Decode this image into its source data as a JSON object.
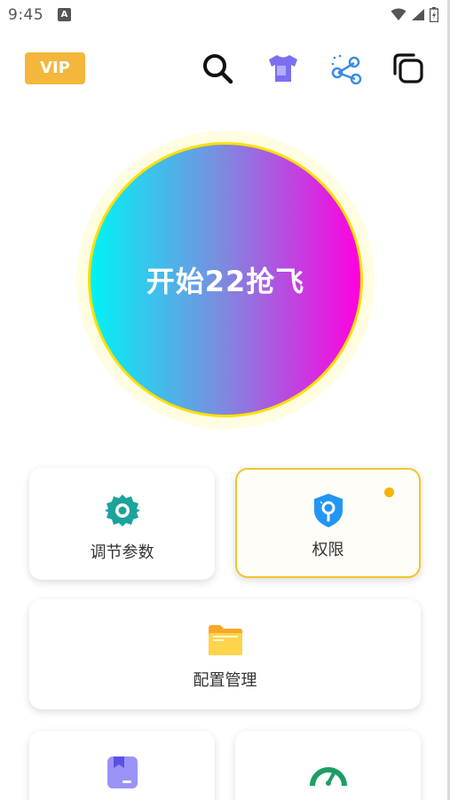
{
  "status_bar": {
    "time": "9:45",
    "app_icon_letter": "A"
  },
  "toolbar": {
    "vip_label": "VIP",
    "icons": [
      "search-icon",
      "tshirt-icon",
      "share-icon",
      "copy-icon"
    ]
  },
  "main": {
    "start_label": "开始22抢飞"
  },
  "cards": {
    "params_label": "调节参数",
    "permission_label": "权限",
    "config_label": "配置管理"
  },
  "colors": {
    "vip": "#f4b73b",
    "gradient_start": "#00f3f6",
    "gradient_end": "#ff00e0",
    "ring": "#ffe000",
    "teal": "#1aa39a",
    "blue": "#2196f3",
    "folder": "#fbc02d",
    "notice_dot": "#f5b400"
  }
}
